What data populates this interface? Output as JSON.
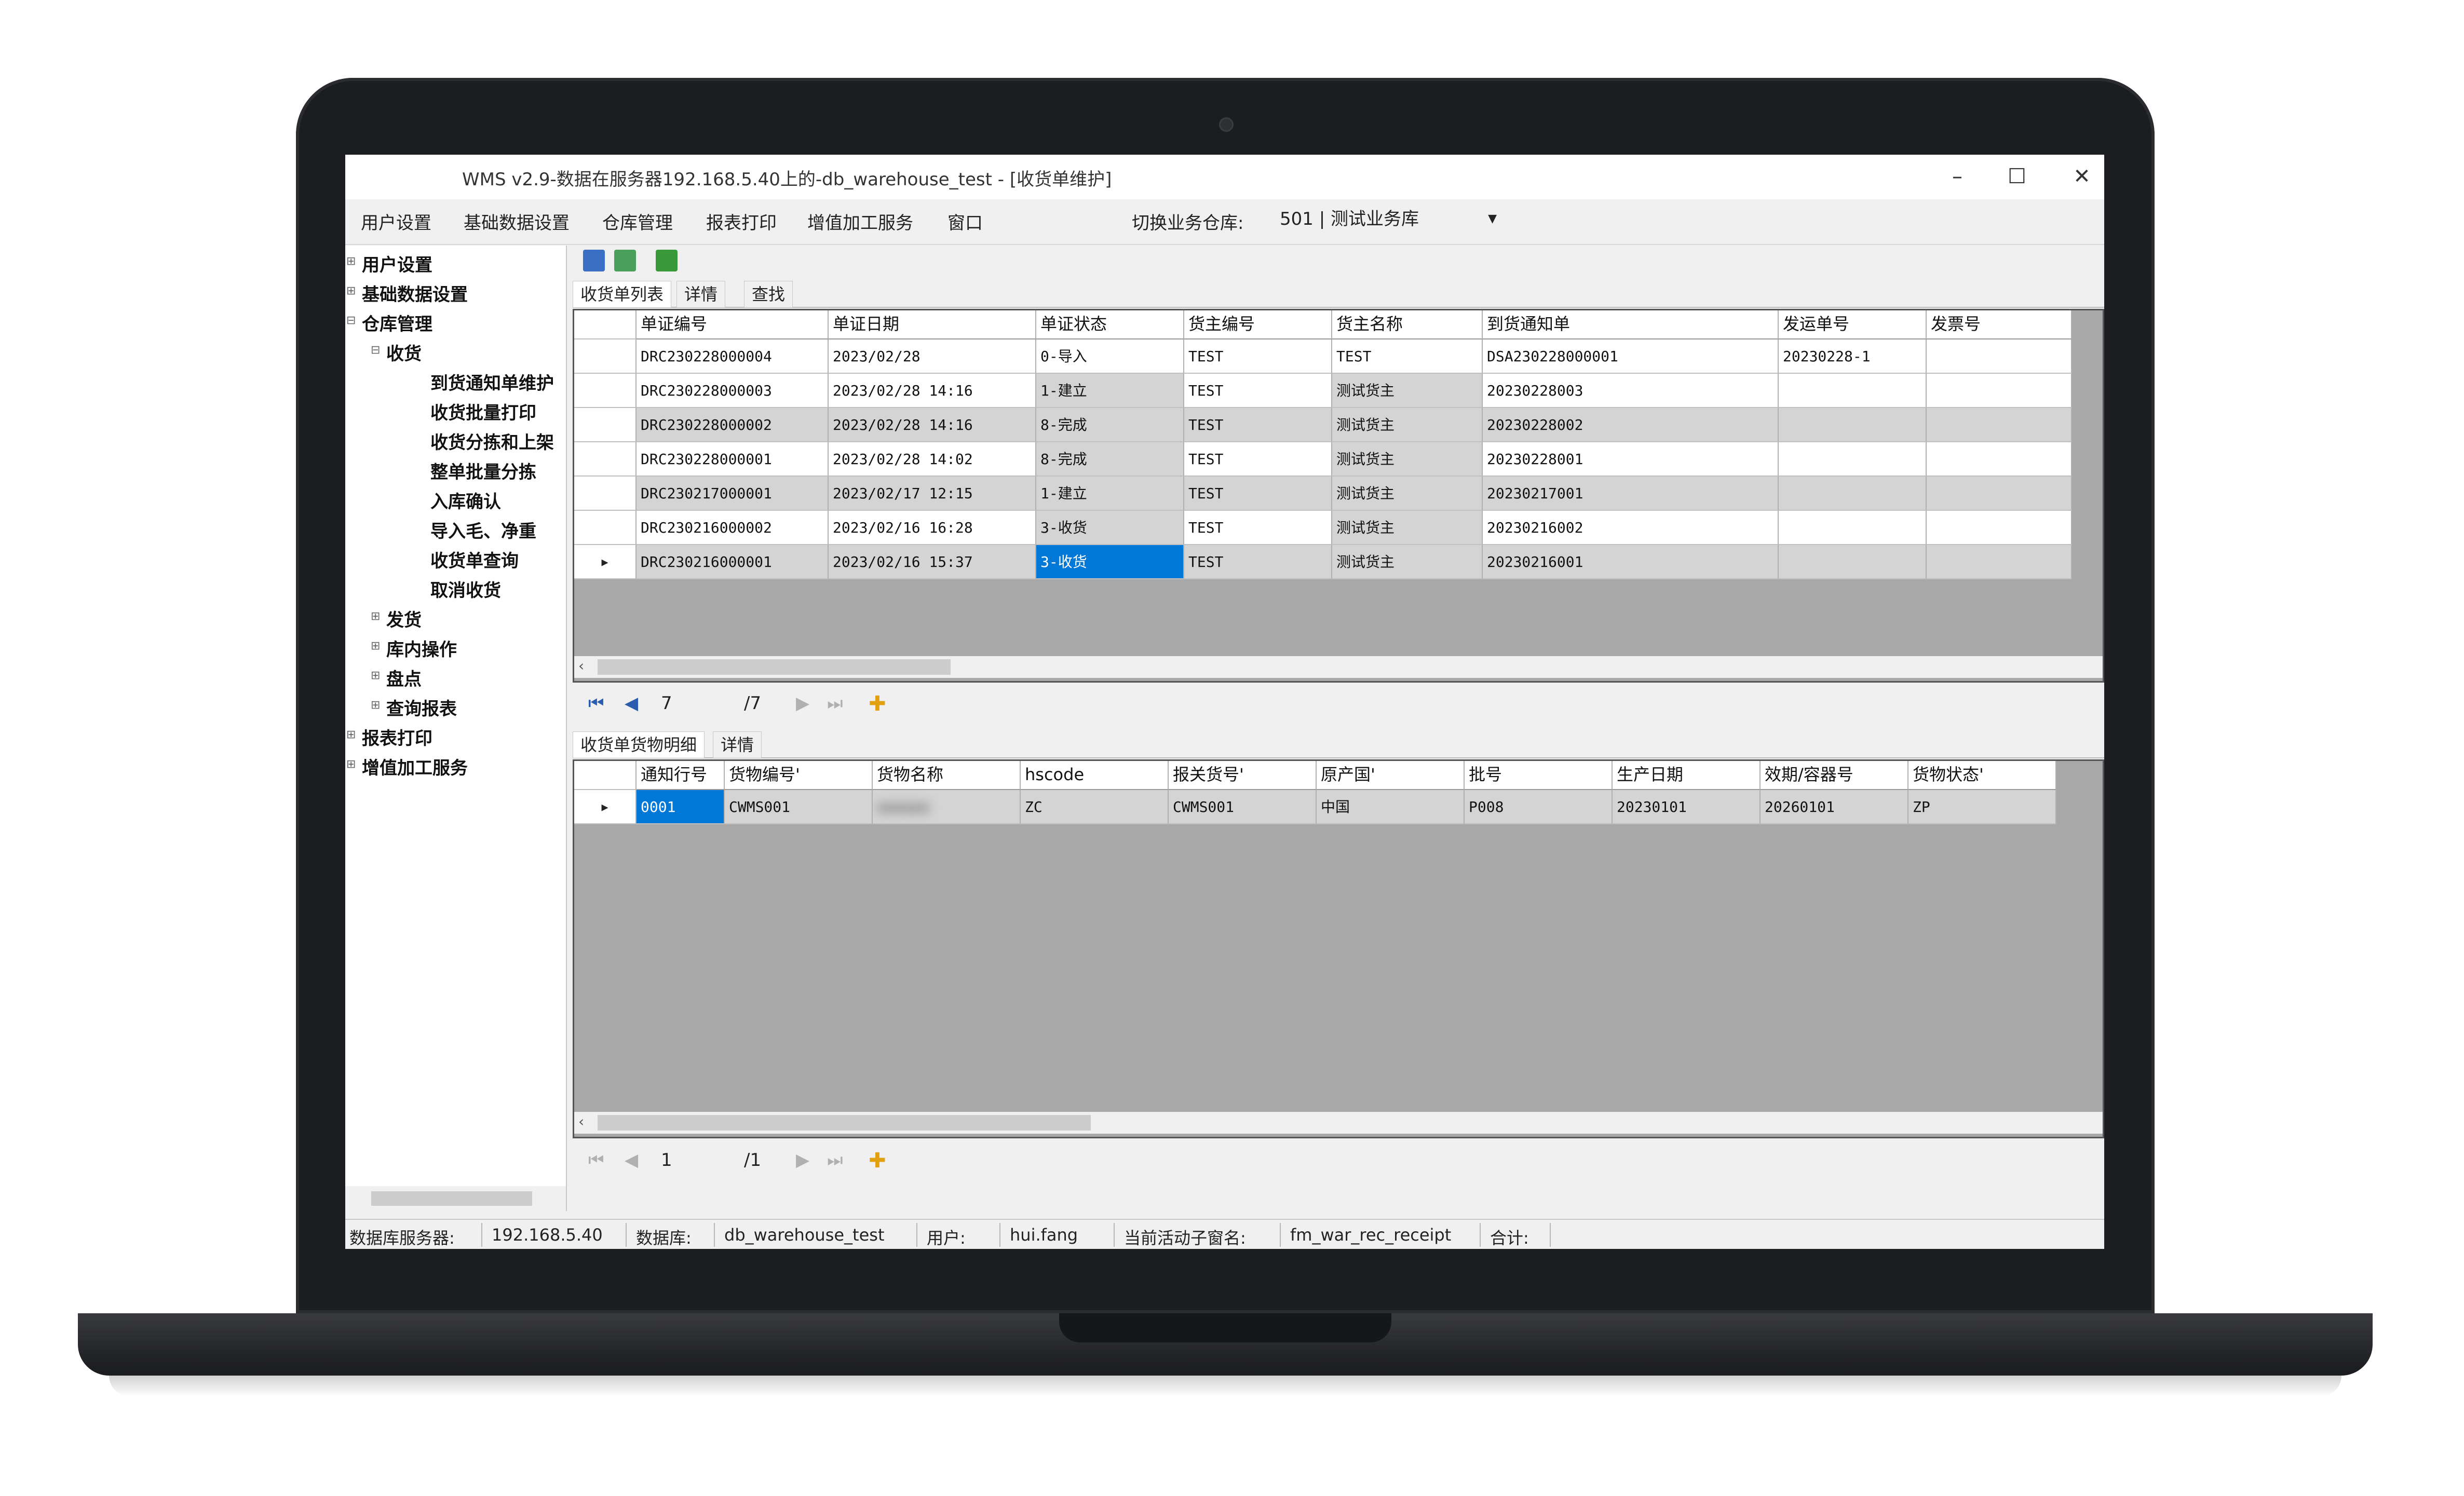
{
  "window": {
    "title": "WMS v2.9-数据在服务器192.168.5.40上的-db_warehouse_test - [收货单维护]",
    "minimize": "–",
    "maximize": "☐",
    "close": "✕"
  },
  "menu": [
    "用户设置",
    "基础数据设置",
    "仓库管理",
    "报表打印",
    "增值加工服务",
    "窗口"
  ],
  "warehouse": {
    "label": "切换业务仓库:",
    "value": "501 | 测试业务库"
  },
  "tree": [
    {
      "label": "用户设置",
      "level": 0
    },
    {
      "label": "基础数据设置",
      "level": 0
    },
    {
      "label": "仓库管理",
      "level": 0
    },
    {
      "label": "收货",
      "level": 1
    },
    {
      "label": "到货通知单维护",
      "level": 2
    },
    {
      "label": "收货批量打印",
      "level": 2
    },
    {
      "label": "收货分拣和上架",
      "level": 2
    },
    {
      "label": "整单批量分拣",
      "level": 2
    },
    {
      "label": "入库确认",
      "level": 2
    },
    {
      "label": "导入毛、净重",
      "level": 2
    },
    {
      "label": "收货单查询",
      "level": 2
    },
    {
      "label": "取消收货",
      "level": 2
    },
    {
      "label": "发货",
      "level": 1
    },
    {
      "label": "库内操作",
      "level": 1
    },
    {
      "label": "盘点",
      "level": 1
    },
    {
      "label": "查询报表",
      "level": 1
    },
    {
      "label": "报表打印",
      "level": 0
    },
    {
      "label": "增值加工服务",
      "level": 0
    }
  ],
  "top_tabs": [
    "收货单列表",
    "详情",
    "查找"
  ],
  "top_grid": {
    "columns": [
      "单证编号",
      "单证日期",
      "单证状态",
      "货主编号",
      "货主名称",
      "到货通知单",
      "发运单号",
      "发票号"
    ],
    "rows": [
      [
        "DRC230228000004",
        "2023/02/28",
        "0-导入",
        "TEST",
        "TEST",
        "DSA230228000001",
        "20230228-1",
        ""
      ],
      [
        "DRC230228000003",
        "2023/02/28 14:16",
        "1-建立",
        "TEST",
        "测试货主",
        "20230228003",
        "",
        ""
      ],
      [
        "DRC230228000002",
        "2023/02/28 14:16",
        "8-完成",
        "TEST",
        "测试货主",
        "20230228002",
        "",
        ""
      ],
      [
        "DRC230228000001",
        "2023/02/28 14:02",
        "8-完成",
        "TEST",
        "测试货主",
        "20230228001",
        "",
        ""
      ],
      [
        "DRC230217000001",
        "2023/02/17 12:15",
        "1-建立",
        "TEST",
        "测试货主",
        "20230217001",
        "",
        ""
      ],
      [
        "DRC230216000002",
        "2023/02/16 16:28",
        "3-收货",
        "TEST",
        "测试货主",
        "20230216002",
        "",
        ""
      ],
      [
        "DRC230216000001",
        "2023/02/16 15:37",
        "3-收货",
        "TEST",
        "测试货主",
        "20230216001",
        "",
        ""
      ]
    ],
    "current_row_marker": "▸"
  },
  "top_nav": {
    "current": "7",
    "total": "/7"
  },
  "bottom_tabs": [
    "收货单货物明细",
    "详情"
  ],
  "bottom_grid": {
    "columns": [
      "通知行号",
      "货物编号'",
      "货物名称",
      "hscode",
      "报关货号'",
      "原产国'",
      "批号",
      "生产日期",
      "效期/容器号",
      "货物状态'"
    ],
    "rows": [
      [
        "0001",
        "CWMS001",
        "",
        "ZC",
        "CWMS001",
        "中国",
        "P008",
        "20230101",
        "20260101",
        "ZP"
      ]
    ]
  },
  "bottom_nav": {
    "current": "1",
    "total": "/1"
  },
  "status": {
    "db_server_label": "数据库服务器:",
    "db_server": "192.168.5.40",
    "db_label": "数据库:",
    "db": "db_warehouse_test",
    "user_label": "用户:",
    "user": "hui.fang",
    "window_label": "当前活动子窗名:",
    "window": "fm_war_rec_receipt",
    "total_label": "合计:"
  },
  "colors": {
    "selection": "#0078d7",
    "grid_bg": "#a8a8a8",
    "row_alt": "#d4d4d4"
  }
}
